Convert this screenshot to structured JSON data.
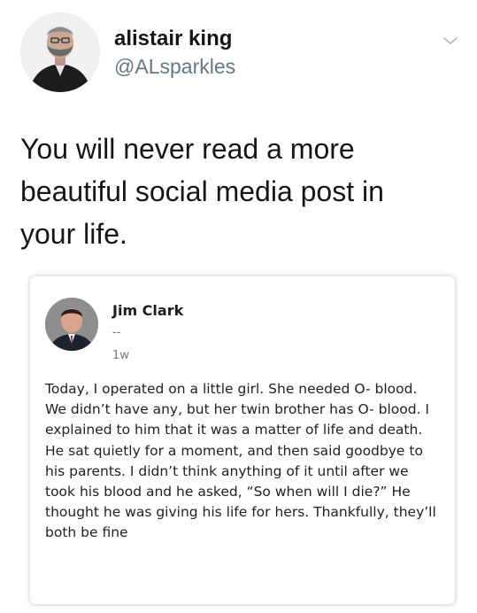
{
  "tweet": {
    "author": {
      "display_name": "alistair king",
      "handle": "@ALsparkles",
      "avatar_icon": "profile-photo-man-with-beard"
    },
    "menu_icon": "chevron-down-icon",
    "text": "You will never read a more beautiful social media post in your life."
  },
  "quoted_post": {
    "author": {
      "name": "Jim Clark",
      "subtitle": "--",
      "avatar_icon": "profile-photo-man-in-suit"
    },
    "time": "1w",
    "text": "Today, I operated on a little girl. She needed O- blood. We didn’t have any, but her twin brother has O- blood. I explained to him that it was a matter of life and death. He sat quietly for a moment, and then said goodbye to his parents. I didn’t think anything of it until after we took his blood and he asked, “So when will I die?” He thought he was giving his life for hers. Thankfully, they’ll both be fine"
  },
  "colors": {
    "text_primary": "#14171a",
    "text_secondary": "#657786",
    "card_text": "#222222",
    "card_meta": "#777777"
  }
}
